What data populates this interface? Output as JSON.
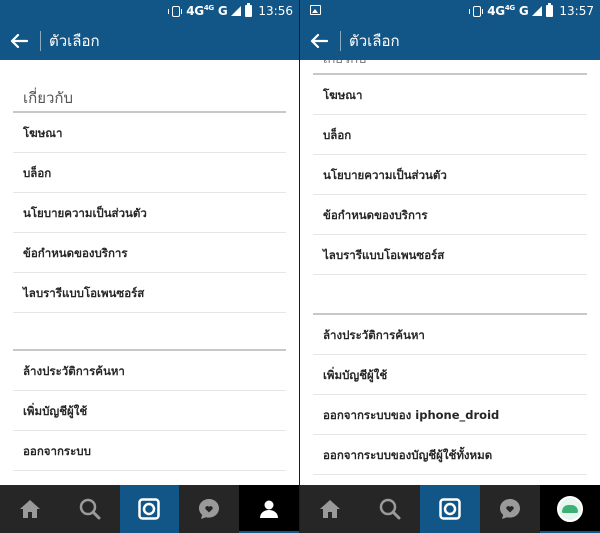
{
  "colors": {
    "primary": "#125688",
    "tabbar": "#262626",
    "divider": "#c8c8c8"
  },
  "left": {
    "status": {
      "network": "4G",
      "network_sup": "4G",
      "network2": "G",
      "time": "13:56"
    },
    "title": "ตัวเลือก",
    "section_title": "เกี่ยวกับ",
    "about_items": [
      "โฆษณา",
      "บล็อก",
      "นโยบายความเป็นส่วนตัว",
      "ข้อกำหนดของบริการ",
      "ไลบรารีแบบโอเพนซอร์ส"
    ],
    "account_items": [
      "ล้างประวัติการค้นหา",
      "เพิ่มบัญชีผู้ใช้",
      "ออกจากระบบ"
    ]
  },
  "right": {
    "status": {
      "network": "4G",
      "network_sup": "4G",
      "network2": "G",
      "time": "13:57"
    },
    "title": "ตัวเลือก",
    "section_title_partial": "เกี่ยวกับ",
    "about_items": [
      "โฆษณา",
      "บล็อก",
      "นโยบายความเป็นส่วนตัว",
      "ข้อกำหนดของบริการ",
      "ไลบรารีแบบโอเพนซอร์ส"
    ],
    "account_items": [
      "ล้างประวัติการค้นหา",
      "เพิ่มบัญชีผู้ใช้",
      "ออกจากระบบของ iphone_droid",
      "ออกจากระบบของบัญชีผู้ใช้ทั้งหมด"
    ]
  },
  "tabs": [
    "home-icon",
    "search-icon",
    "camera-icon",
    "activity-icon",
    "profile-icon"
  ]
}
